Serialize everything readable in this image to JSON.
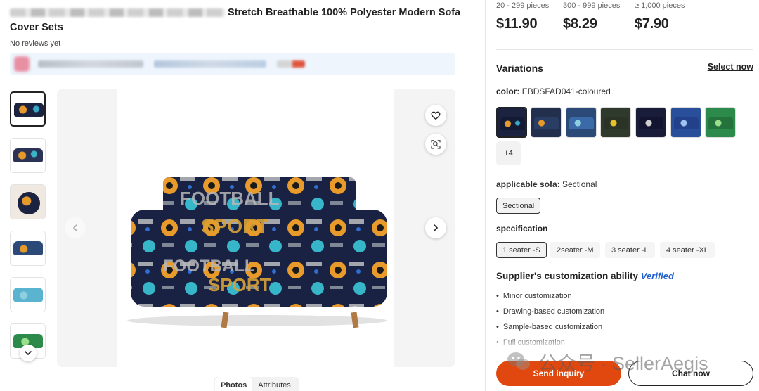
{
  "product": {
    "title": "Stretch Breathable 100% Polyester Modern Sofa Cover Sets",
    "reviews": "No reviews yet"
  },
  "gallery": {
    "tabs": [
      "Photos",
      "Attributes"
    ],
    "active_tab": "Photos",
    "thumbnails": [
      "sofa-front",
      "sofa-set",
      "cushion-detail",
      "sofa-blue",
      "sofa-lightblue",
      "sofa-green"
    ],
    "icons": {
      "favorite": "heart-icon",
      "image_search": "image-search-icon",
      "prev": "chevron-left-icon",
      "next": "chevron-right-icon",
      "more": "chevron-down-icon"
    }
  },
  "pricing": {
    "tiers": [
      {
        "qty": "20 - 299 pieces",
        "price": "$11.90"
      },
      {
        "qty": "300 - 999 pieces",
        "price": "$8.29"
      },
      {
        "qty": "≥ 1,000 pieces",
        "price": "$7.90"
      }
    ]
  },
  "variations": {
    "title": "Variations",
    "select_now": "Select now",
    "color_label": "color:",
    "color_value": "EBDSFAD041-coloured",
    "swatch_colors": [
      "#1b2340",
      "#23304d",
      "#2b4a78",
      "#2f3a2c",
      "#1a1d3a",
      "#2a4f9a",
      "#2c8a4a"
    ],
    "more_colors": "+4",
    "sofa_label": "applicable sofa:",
    "sofa_value": "Sectional",
    "sofa_options": [
      "Sectional"
    ],
    "spec_title": "specification",
    "spec_options": [
      "1 seater -S",
      "2seater -M",
      "3 seater -L",
      "4 seater -XL"
    ],
    "spec_selected": "1 seater -S"
  },
  "customization": {
    "title": "Supplier's customization ability",
    "badge": "Verified",
    "items": [
      "Minor customization",
      "Drawing-based customization",
      "Sample-based customization",
      "Full customization"
    ]
  },
  "actions": {
    "send_inquiry": "Send inquiry",
    "chat_now": "Chat now"
  },
  "watermark": {
    "text": "公众号 · SellerAegis"
  },
  "colors": {
    "accent": "#e0480f",
    "verified": "#1f5fd0",
    "store_bar": "#eef5fd"
  }
}
